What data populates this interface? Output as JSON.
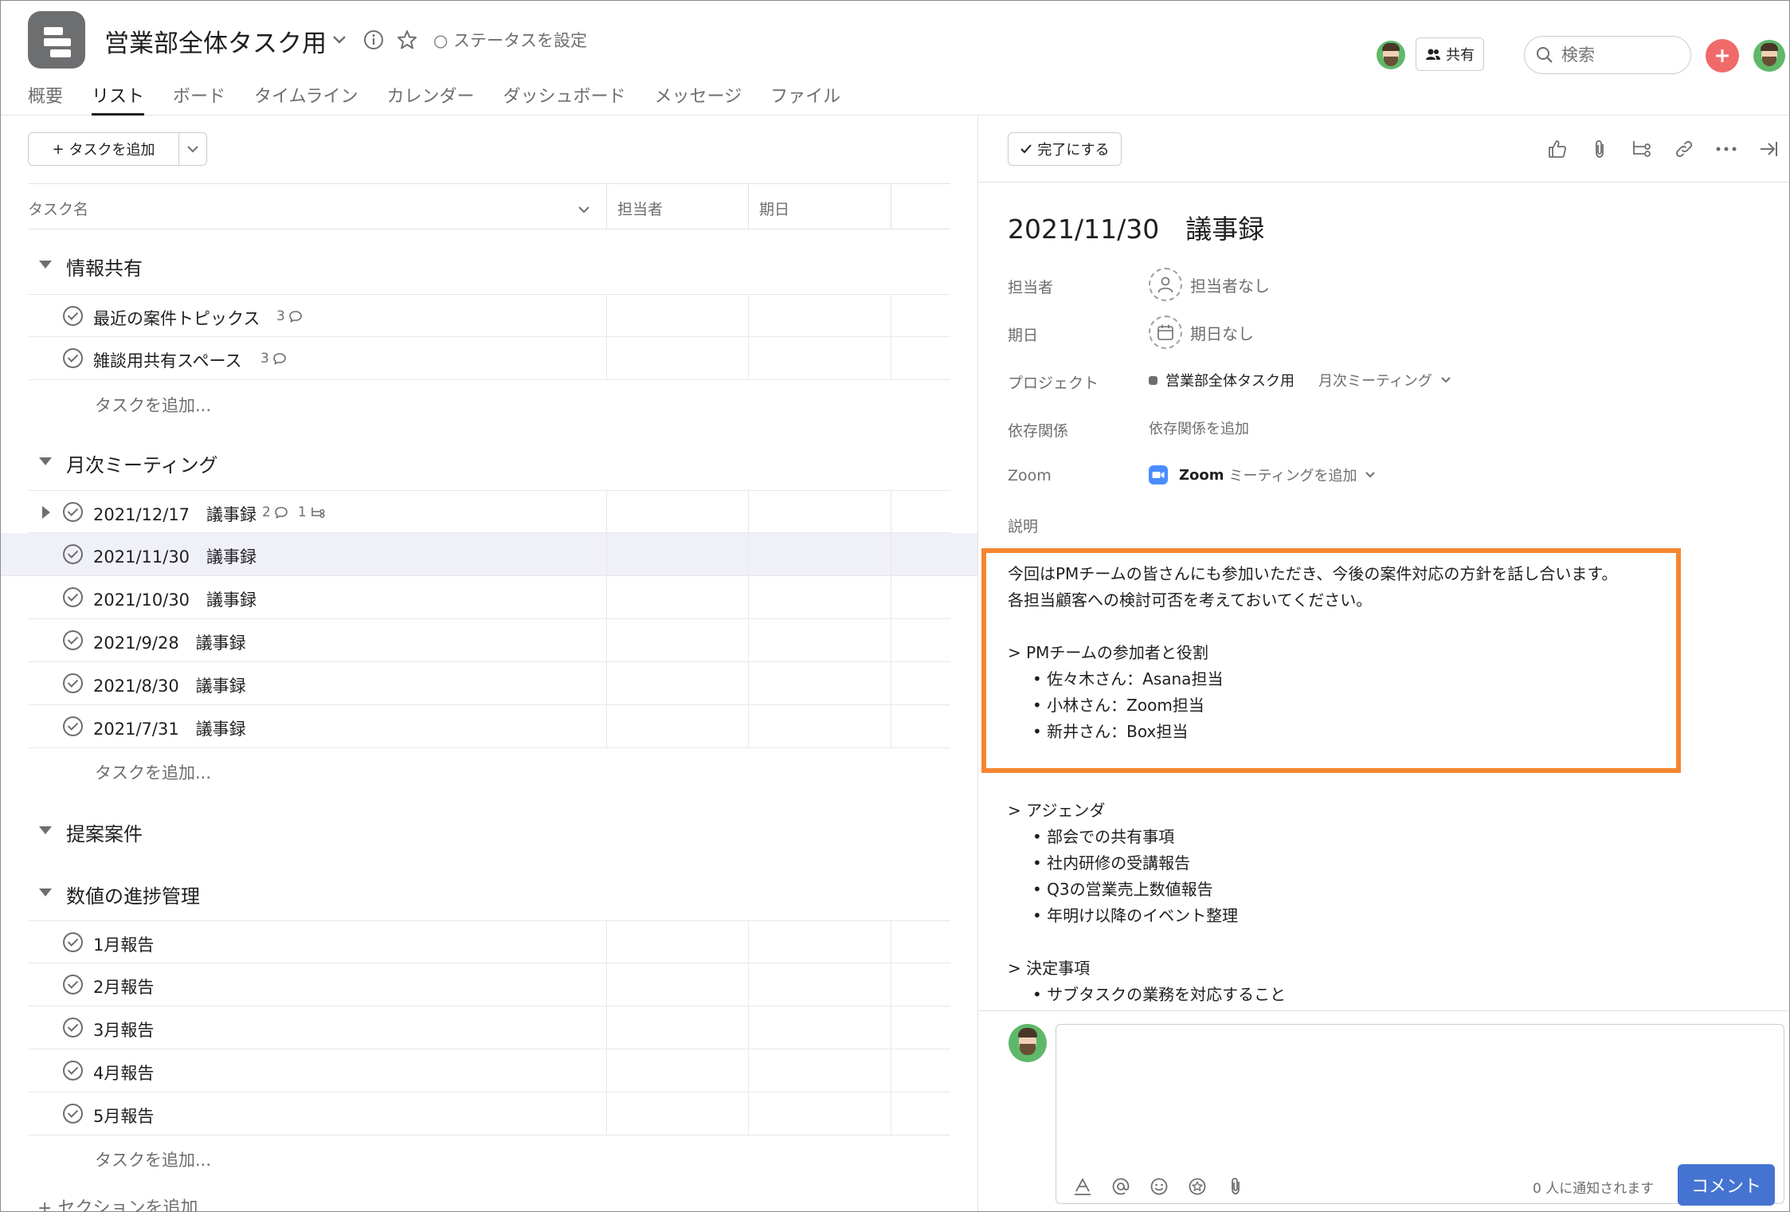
{
  "header": {
    "project_title": "営業部全体タスク用",
    "status": "ステータスを設定",
    "share_label": "共有",
    "search_placeholder": "検索",
    "tabs": [
      {
        "label": "概要"
      },
      {
        "label": "リスト"
      },
      {
        "label": "ボード"
      },
      {
        "label": "タイムライン"
      },
      {
        "label": "カレンダー"
      },
      {
        "label": "ダッシュボード"
      },
      {
        "label": "メッセージ"
      },
      {
        "label": "ファイル"
      }
    ],
    "active_tab": "リスト"
  },
  "list": {
    "add_task_label": "タスクを追加",
    "columns": {
      "name": "タスク名",
      "assignee": "担当者",
      "due": "期日"
    },
    "add_task_inline": "タスクを追加...",
    "add_section": "セクションを追加",
    "sections": [
      {
        "title": "情報共有",
        "tasks": [
          {
            "name": "最近の案件トピックス",
            "comments": "3"
          },
          {
            "name": "雑談用共有スペース",
            "comments": "3"
          }
        ]
      },
      {
        "title": "月次ミーティング",
        "tasks": [
          {
            "name": "2021/12/17　議事録",
            "comments": "2",
            "subtasks": "1"
          },
          {
            "name": "2021/11/30　議事録"
          },
          {
            "name": "2021/10/30　議事録"
          },
          {
            "name": "2021/9/28　議事録"
          },
          {
            "name": "2021/8/30　議事録"
          },
          {
            "name": "2021/7/31　議事録"
          }
        ]
      },
      {
        "title": "提案案件",
        "tasks": []
      },
      {
        "title": "数値の進捗管理",
        "tasks": [
          {
            "name": "1月報告"
          },
          {
            "name": "2月報告"
          },
          {
            "name": "3月報告"
          },
          {
            "name": "4月報告"
          },
          {
            "name": "5月報告"
          }
        ]
      }
    ]
  },
  "detail": {
    "complete_label": "完了にする",
    "title": "2021/11/30　議事録",
    "fields": {
      "assignee_label": "担当者",
      "assignee_value": "担当者なし",
      "due_label": "期日",
      "due_value": "期日なし",
      "project_label": "プロジェクト",
      "project_value": "営業部全体タスク用",
      "project_section": "月次ミーティング",
      "dependency_label": "依存関係",
      "dependency_value": "依存関係を追加",
      "zoom_label": "Zoom",
      "zoom_bold": "Zoom",
      "zoom_value": "ミーティングを追加",
      "description_label": "説明"
    },
    "description": {
      "intro1": "今回はPMチームの皆さんにも参加いただき、今後の案件対応の方針を話し合います。",
      "intro2": "各担当顧客への検討可否を考えておいてください。",
      "pm_heading": "> PMチームの参加者と役割",
      "pm_members": [
        "• 佐々木さん：Asana担当",
        "• 小林さん：Zoom担当",
        "• 新井さん：Box担当"
      ],
      "agenda_heading": "> アジェンダ",
      "agenda": [
        "• 部会での共有事項",
        "• 社内研修の受講報告",
        "• Q3の営業売上数値報告",
        "• 年明け以降のイベント整理"
      ],
      "decision_heading": "> 決定事項",
      "decisions": [
        "• サブタスクの業務を対応すること"
      ]
    },
    "comment": {
      "notify": "0 人に通知されます",
      "button": "コメント"
    }
  },
  "colors": {
    "accent": "#4573d2",
    "highlight_border": "#f5862f",
    "add_button": "#f06a6a",
    "project_icon": "#6d6e6f"
  }
}
